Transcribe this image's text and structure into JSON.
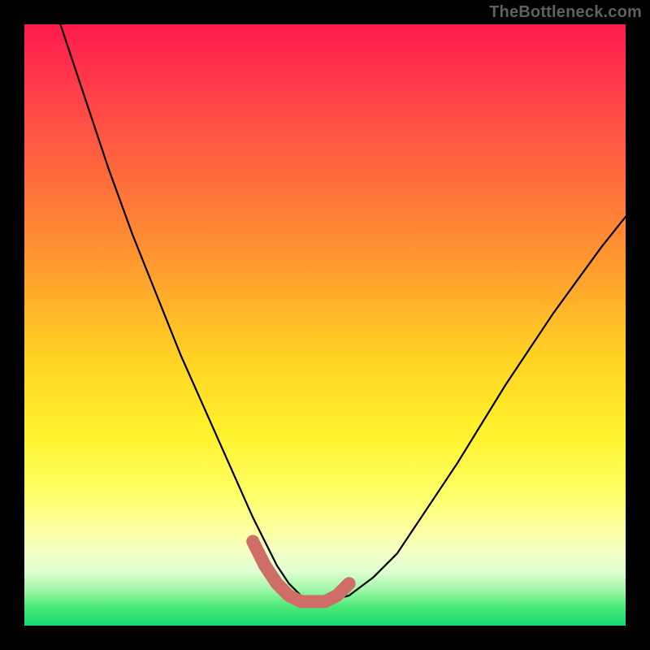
{
  "watermark": {
    "text": "TheBottleneck.com"
  },
  "chart_data": {
    "type": "line",
    "title": "",
    "xlabel": "",
    "ylabel": "",
    "xlim": [
      0,
      100
    ],
    "ylim": [
      0,
      100
    ],
    "grid": false,
    "legend": false,
    "series": [
      {
        "name": "bottleneck-curve",
        "x": [
          6,
          10,
          14,
          18,
          22,
          26,
          30,
          34,
          38,
          40,
          42,
          44,
          46,
          48,
          50,
          54,
          58,
          62,
          66,
          72,
          80,
          88,
          96,
          100
        ],
        "values": [
          100,
          88,
          76,
          65,
          55,
          45,
          36,
          27,
          18,
          14,
          10,
          7,
          5,
          4,
          4,
          5,
          8,
          12,
          18,
          27,
          40,
          52,
          63,
          68
        ]
      },
      {
        "name": "optimal-range-highlight",
        "x": [
          38,
          40,
          42,
          44,
          46,
          48,
          50,
          52,
          54
        ],
        "values": [
          14,
          10,
          7,
          5,
          4,
          4,
          4,
          5,
          7
        ]
      }
    ],
    "background_gradient": {
      "direction": "vertical",
      "stops": [
        {
          "pos": 0.0,
          "color": "#ff1a4d"
        },
        {
          "pos": 0.4,
          "color": "#ff9a2e"
        },
        {
          "pos": 0.68,
          "color": "#fff22b"
        },
        {
          "pos": 0.88,
          "color": "#f4ffc8"
        },
        {
          "pos": 1.0,
          "color": "#16d873"
        }
      ]
    }
  }
}
